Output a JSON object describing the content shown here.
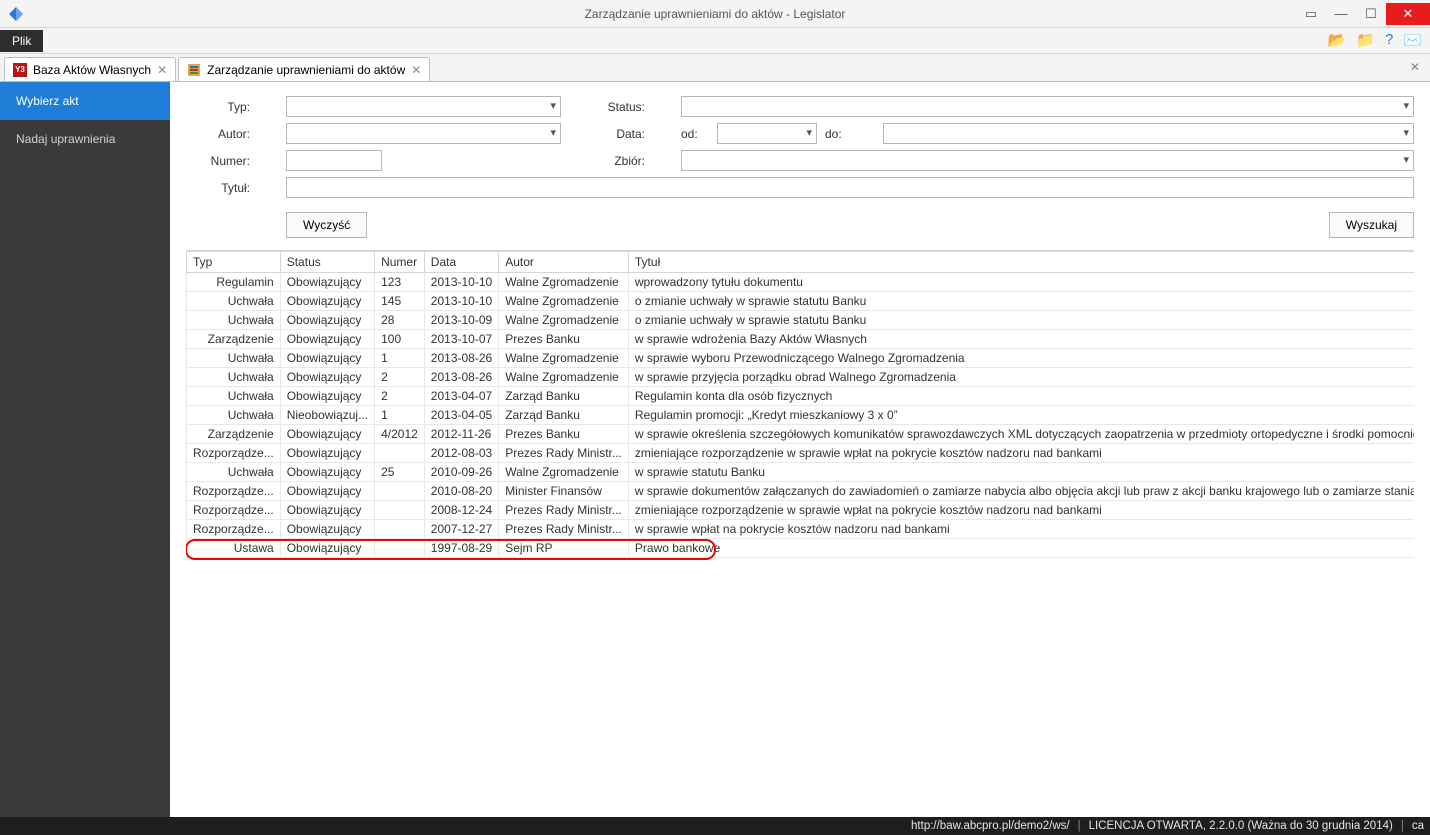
{
  "window": {
    "title": "Zarządzanie uprawnieniami do aktów - Legislator"
  },
  "menu": {
    "file": "Plik"
  },
  "tabs": [
    {
      "label": "Baza Aktów Własnych",
      "iconColor": "#b21818",
      "iconText": "Y3"
    },
    {
      "label": "Zarządzanie uprawnieniami do aktów",
      "iconColor": "#1f6fd0",
      "iconText": "≡"
    }
  ],
  "sidebar": {
    "items": [
      {
        "label": "Wybierz akt",
        "active": true
      },
      {
        "label": "Nadaj uprawnienia",
        "active": false
      }
    ]
  },
  "filters": {
    "labels": {
      "typ": "Typ:",
      "autor": "Autor:",
      "numer": "Numer:",
      "tytul": "Tytuł:",
      "status": "Status:",
      "data": "Data:",
      "od": "od:",
      "do": "do:",
      "zbior": "Zbiór:"
    },
    "values": {
      "typ": "",
      "autor": "",
      "numer": "",
      "tytul": "",
      "status": "",
      "od": "",
      "do": "",
      "zbior": ""
    },
    "buttons": {
      "clear": "Wyczyść",
      "search": "Wyszukaj"
    }
  },
  "table": {
    "headers": {
      "typ": "Typ",
      "status": "Status",
      "numer": "Numer",
      "data": "Data",
      "autor": "Autor",
      "tytul": "Tytuł"
    },
    "rows": [
      {
        "typ": "Regulamin",
        "status": "Obowiązujący",
        "numer": "123",
        "data": "2013-10-10",
        "autor": "Walne Zgromadzenie",
        "tytul": "wprowadzony tytułu dokumentu"
      },
      {
        "typ": "Uchwała",
        "status": "Obowiązujący",
        "numer": "145",
        "data": "2013-10-10",
        "autor": "Walne Zgromadzenie",
        "tytul": "o zmianie uchwały w sprawie statutu Banku"
      },
      {
        "typ": "Uchwała",
        "status": "Obowiązujący",
        "numer": "28",
        "data": "2013-10-09",
        "autor": "Walne Zgromadzenie",
        "tytul": "o zmianie uchwały w sprawie statutu Banku"
      },
      {
        "typ": "Zarządzenie",
        "status": "Obowiązujący",
        "numer": "100",
        "data": "2013-10-07",
        "autor": "Prezes Banku",
        "tytul": "w sprawie wdrożenia Bazy Aktów Własnych"
      },
      {
        "typ": "Uchwała",
        "status": "Obowiązujący",
        "numer": "1",
        "data": "2013-08-26",
        "autor": "Walne Zgromadzenie",
        "tytul": "w sprawie wyboru Przewodniczącego Walnego Zgromadzenia"
      },
      {
        "typ": "Uchwała",
        "status": "Obowiązujący",
        "numer": "2",
        "data": "2013-08-26",
        "autor": "Walne Zgromadzenie",
        "tytul": "w sprawie przyjęcia porządku obrad Walnego Zgromadzenia"
      },
      {
        "typ": "Uchwała",
        "status": "Obowiązujący",
        "numer": "2",
        "data": "2013-04-07",
        "autor": "Zarząd Banku",
        "tytul": "Regulamin konta dla osób fizycznych"
      },
      {
        "typ": "Uchwała",
        "status": "Nieobowiązuj...",
        "numer": "1",
        "data": "2013-04-05",
        "autor": "Zarząd Banku",
        "tytul": "Regulamin promocji: „Kredyt mieszkaniowy 3 x 0”"
      },
      {
        "typ": "Zarządzenie",
        "status": "Obowiązujący",
        "numer": "4/2012",
        "data": "2012-11-26",
        "autor": "Prezes Banku",
        "tytul": "w sprawie określenia szczegółowych komunikatów sprawozdawczych XML dotyczących zaopatrzenia w przedmioty ortopedyczne i środki pomocnicze"
      },
      {
        "typ": "Rozporządze...",
        "status": "Obowiązujący",
        "numer": "",
        "data": "2012-08-03",
        "autor": "Prezes Rady Ministr...",
        "tytul": "zmieniające rozporządzenie w sprawie wpłat na pokrycie kosztów nadzoru nad bankami"
      },
      {
        "typ": "Uchwała",
        "status": "Obowiązujący",
        "numer": "25",
        "data": "2010-09-26",
        "autor": "Walne Zgromadzenie",
        "tytul": "w sprawie statutu Banku"
      },
      {
        "typ": "Rozporządze...",
        "status": "Obowiązujący",
        "numer": "",
        "data": "2010-08-20",
        "autor": "Minister Finansów",
        "tytul": "w sprawie dokumentów załączanych do zawiadomień o zamiarze nabycia albo objęcia akcji lub praw z akcji banku krajowego lub o zamiarze stania się podmiotem..."
      },
      {
        "typ": "Rozporządze...",
        "status": "Obowiązujący",
        "numer": "",
        "data": "2008-12-24",
        "autor": "Prezes Rady Ministr...",
        "tytul": "zmieniające rozporządzenie w sprawie wpłat na pokrycie kosztów nadzoru nad bankami"
      },
      {
        "typ": "Rozporządze...",
        "status": "Obowiązujący",
        "numer": "",
        "data": "2007-12-27",
        "autor": "Prezes Rady Ministr...",
        "tytul": "w sprawie wpłat na pokrycie kosztów nadzoru nad bankami"
      },
      {
        "typ": "Ustawa",
        "status": "Obowiązujący",
        "numer": "",
        "data": "1997-08-29",
        "autor": "Sejm RP",
        "tytul": "Prawo bankowe",
        "highlight": true
      }
    ]
  },
  "statusbar": {
    "url": "http://baw.abcpro.pl/demo2/ws/",
    "license": "LICENCJA OTWARTA, 2.2.0.0 (Ważna do 30 grudnia 2014)",
    "lang": "ca"
  }
}
